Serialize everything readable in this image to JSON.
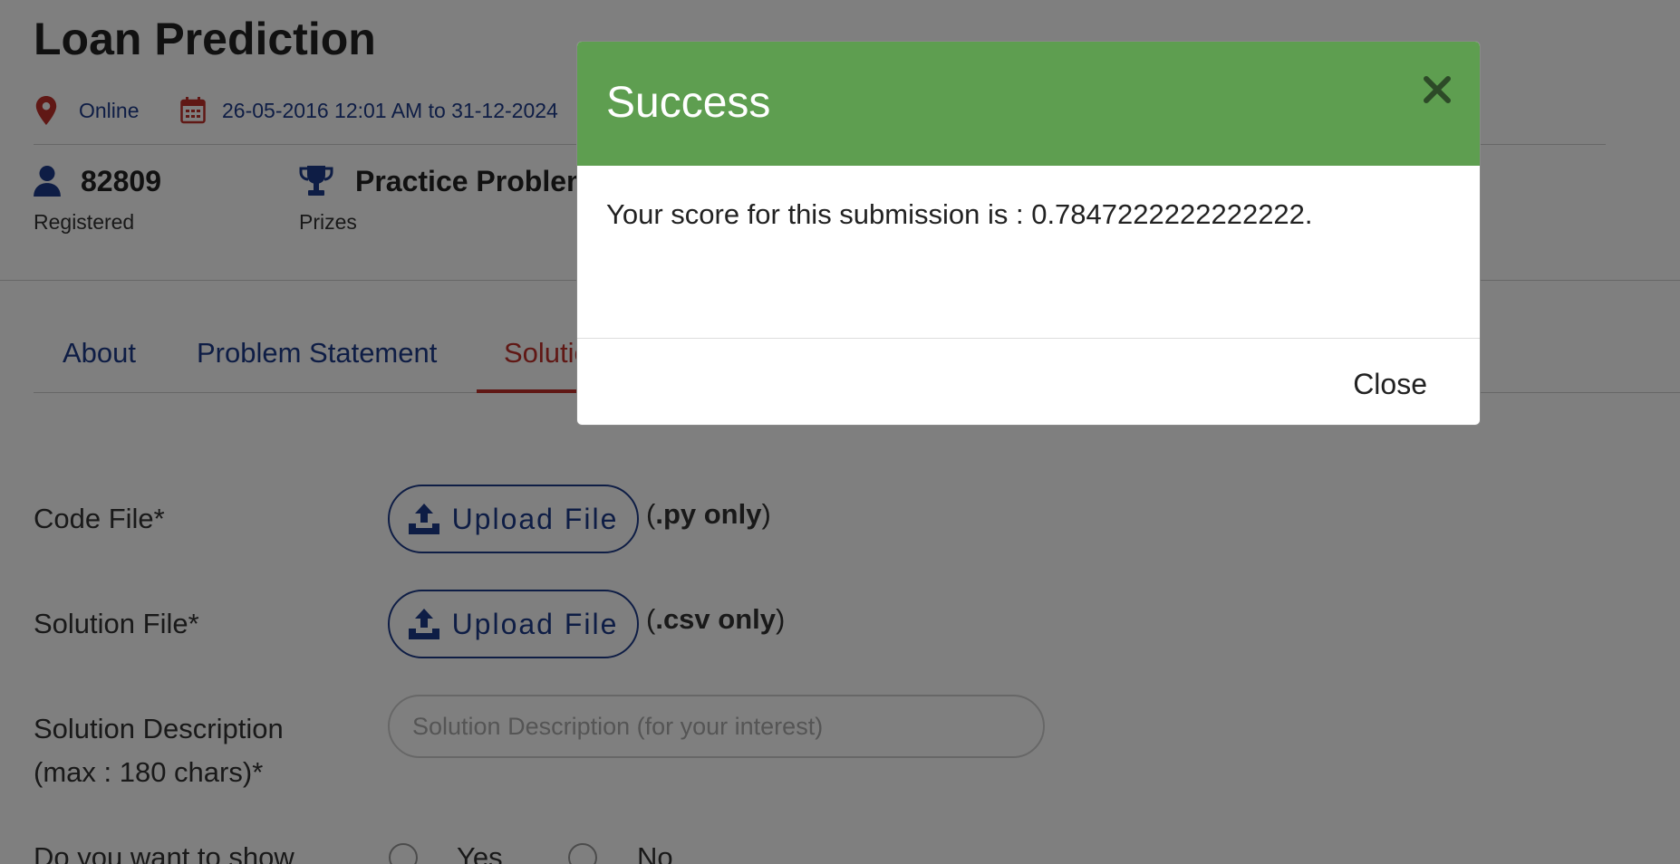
{
  "header": {
    "title": "Loan Prediction",
    "location": "Online",
    "dates": "26-05-2016 12:01 AM to 31-12-2024"
  },
  "stats": [
    {
      "value": "82809",
      "label": "Registered",
      "icon": "user-icon"
    },
    {
      "value": "Practice Problem",
      "label": "Prizes",
      "icon": "trophy-icon"
    }
  ],
  "tabs": [
    {
      "label": "About"
    },
    {
      "label": "Problem Statement"
    },
    {
      "label": "Solution",
      "active": true
    }
  ],
  "form": {
    "code_file_label": "Code File*",
    "solution_file_label": "Solution File*",
    "upload_label": "Upload File",
    "py_hint_open": "(",
    "py_hint_bold": ".py only",
    "py_hint_close": ")",
    "csv_hint_open": "(",
    "csv_hint_bold": ".csv only",
    "csv_hint_close": ")",
    "desc_label_line1": "Solution Description",
    "desc_label_line2": "(max : 180 chars)*",
    "desc_placeholder": "Solution Description (for your interest)",
    "radio_label_partial": "Do you want to show",
    "radio_yes": "Yes",
    "radio_no": "No"
  },
  "modal": {
    "title": "Success",
    "message": "Your score for this submission is : 0.7847222222222222.",
    "close_label": "Close"
  },
  "colors": {
    "brand_blue": "#1d3a8a",
    "accent_red": "#c0312b",
    "success_green": "#5e9e50"
  }
}
